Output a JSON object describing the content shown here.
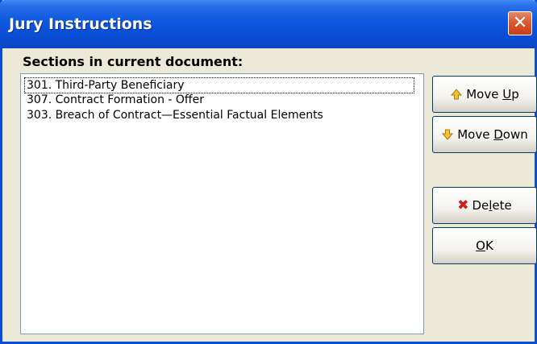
{
  "window": {
    "title": "Jury Instructions",
    "close_icon": "close-icon"
  },
  "sections": {
    "label": "Sections in current document:",
    "items": [
      {
        "text": "301. Third-Party Beneficiary",
        "focused": true
      },
      {
        "text": "307. Contract Formation - Offer",
        "focused": false
      },
      {
        "text": "303. Breach of Contract—Essential Factual Elements",
        "focused": false
      }
    ]
  },
  "buttons": {
    "move_up": {
      "prefix": "Move ",
      "mnemonic": "U",
      "suffix": "p",
      "icon": "arrow-up-icon"
    },
    "move_down": {
      "prefix": "Move ",
      "mnemonic": "D",
      "suffix": "own",
      "icon": "arrow-down-icon"
    },
    "delete": {
      "prefix": "De",
      "mnemonic": "l",
      "suffix": "ete",
      "icon": "delete-x-icon"
    },
    "ok": {
      "prefix": "",
      "mnemonic": "O",
      "suffix": "K"
    }
  },
  "colors": {
    "titlebar": "#0A4ED6",
    "dialog_bg": "#ECE9D8",
    "close_button": "#DA5A33",
    "arrow_icon": "#F2C230",
    "delete_icon": "#D11A1A"
  }
}
